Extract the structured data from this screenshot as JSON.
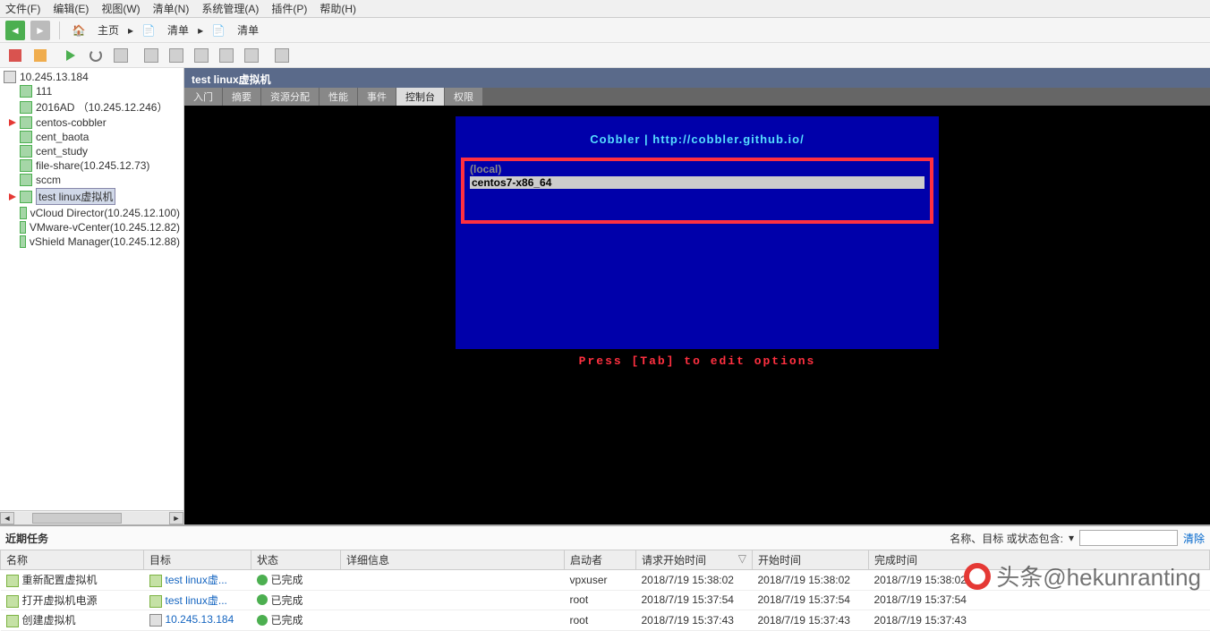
{
  "menu": {
    "file": "文件(F)",
    "edit": "编辑(E)",
    "view": "视图(W)",
    "inventory": "清单(N)",
    "admin": "系统管理(A)",
    "plugins": "插件(P)",
    "help": "帮助(H)"
  },
  "toolbar1": {
    "home": "主页",
    "inventory1": "清单",
    "inventory2": "清单"
  },
  "sidebar": {
    "root": "10.245.13.184",
    "items": [
      {
        "label": "111"
      },
      {
        "label": "2016AD  （10.245.12.246）"
      },
      {
        "label": "centos-cobbler",
        "arrow": true
      },
      {
        "label": "cent_baota"
      },
      {
        "label": "cent_study"
      },
      {
        "label": "file-share(10.245.12.73)"
      },
      {
        "label": "sccm"
      },
      {
        "label": "test linux虚拟机",
        "selected": true,
        "arrow": true
      },
      {
        "label": "vCloud Director(10.245.12.100)"
      },
      {
        "label": "VMware-vCenter(10.245.12.82)"
      },
      {
        "label": "vShield Manager(10.245.12.88)"
      }
    ]
  },
  "content": {
    "title": "test linux虚拟机",
    "tabs": [
      {
        "label": "入门"
      },
      {
        "label": "摘要"
      },
      {
        "label": "资源分配"
      },
      {
        "label": "性能"
      },
      {
        "label": "事件"
      },
      {
        "label": "控制台",
        "active": true
      },
      {
        "label": "权限"
      }
    ],
    "cobbler_title": "Cobbler | http://cobbler.github.io/",
    "boot_local": "(local)",
    "boot_selected": "centos7-x86_64",
    "boot_hint": "Press [Tab] to edit options"
  },
  "tasks": {
    "title": "近期任务",
    "filter_label": "名称、目标 或状态包含: ",
    "clear": "清除",
    "columns": {
      "name": "名称",
      "target": "目标",
      "status": "状态",
      "detail": "详细信息",
      "initiator": "启动者",
      "req_start": "请求开始时间",
      "start": "开始时间",
      "complete": "完成时间"
    },
    "rows": [
      {
        "name": "重新配置虚拟机",
        "target": "test linux虚...",
        "status": "已完成",
        "initiator": "vpxuser",
        "req_start": "2018/7/19 15:38:02",
        "start": "2018/7/19 15:38:02",
        "complete": "2018/7/19 15:38:02"
      },
      {
        "name": "打开虚拟机电源",
        "target": "test linux虚...",
        "status": "已完成",
        "initiator": "root",
        "req_start": "2018/7/19 15:37:54",
        "start": "2018/7/19 15:37:54",
        "complete": "2018/7/19 15:37:54"
      },
      {
        "name": "创建虚拟机",
        "target": "10.245.13.184",
        "target_srv": true,
        "status": "已完成",
        "initiator": "root",
        "req_start": "2018/7/19 15:37:43",
        "start": "2018/7/19 15:37:43",
        "complete": "2018/7/19 15:37:43"
      }
    ]
  },
  "watermark": "头条@hekunranting"
}
